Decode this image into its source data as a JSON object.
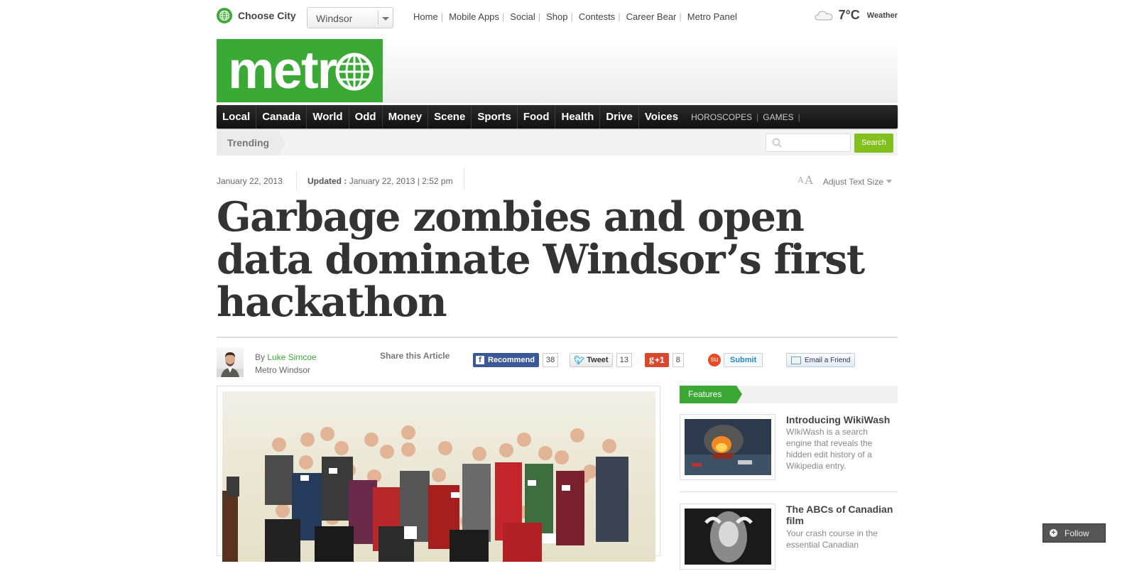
{
  "topbar": {
    "choose_city": "Choose City",
    "city_value": "Windsor",
    "nav": [
      "Home",
      "Mobile Apps",
      "Social",
      "Shop",
      "Contests",
      "Career Bear",
      "Metro Panel"
    ],
    "temperature": "7°C",
    "weather_label": "Weather"
  },
  "logo_text": "metr",
  "mainnav": {
    "sections": [
      "Local",
      "Canada",
      "World",
      "Odd",
      "Money",
      "Scene",
      "Sports",
      "Food",
      "Health",
      "Drive",
      "Voices"
    ],
    "extras": [
      "HOROSCOPES",
      "GAMES"
    ]
  },
  "trending": {
    "label": "Trending",
    "search_placeholder": "",
    "search_button": "Search"
  },
  "article": {
    "date": "January 22, 2013",
    "updated_label": "Updated :",
    "updated_value": "January 22, 2013 | 2:52 pm",
    "text_size_small": "A",
    "text_size_large": "A",
    "adjust_text_size": "Adjust Text Size",
    "headline": "Garbage zombies and open data dominate Windsor’s first hackathon",
    "by": "By",
    "author": "Luke Simcoe",
    "outlet": "Metro Windsor"
  },
  "share": {
    "label": "Share this Article",
    "facebook_label": "Recommend",
    "facebook_count": "38",
    "twitter_label": "Tweet",
    "twitter_count": "13",
    "gplus_label": "+1",
    "gplus_count": "8",
    "stumble_label": "Submit",
    "email_label": "Email a Friend"
  },
  "features": {
    "heading": "Features",
    "items": [
      {
        "title": "Introducing WikiWash",
        "desc": "WIkiWash is a search engine that reveals the hidden edit history of a Wikipedia entry."
      },
      {
        "title": "The ABCs of Canadian film",
        "desc": "Your crash course in the essential Canadian"
      }
    ]
  },
  "follow_label": "Follow",
  "colors": {
    "brand_green": "#3aa935",
    "search_green": "#82c01e",
    "nav_black": "#111111"
  }
}
